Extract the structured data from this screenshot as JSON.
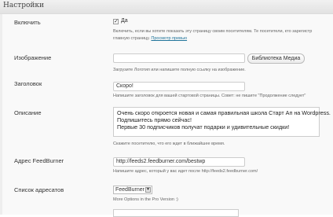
{
  "header": {
    "title": "Настройки"
  },
  "enable": {
    "label": "Включить",
    "checkbox_text": "Да",
    "hint_line1": "Включить, если вы хотите показать эту страницу своим посетителям. Те посетители, кто зарегистр",
    "hint_line2_prefix": "главную страницу.",
    "hint_link": "Просмотр превью"
  },
  "image": {
    "label": "Изображение",
    "value": "",
    "button_label": "Библиотека Медиа",
    "hint": "Загрузите Логотип или напишите полную ссылку на изображение."
  },
  "title_field": {
    "label": "Заголовок",
    "value": "Скоро!",
    "hint": "Напишите заголовок для вашей стартовой страницы. Совет: не пишите \"Продолжение следует\""
  },
  "description": {
    "label": "Описание",
    "lines": [
      "Очень скоро откроется новая и самая правильная школа Старт Ап на Wordpress.",
      "Подпишитесь прямо сейчас!",
      "Первые 30 подписчиков получат подарки и удивительные скидки!"
    ],
    "hint": "Скажите посетителю, что его ждет в ближайшее время."
  },
  "feedburner": {
    "label": "Адрес FeedBurner",
    "value": "http://feeds2.feedburner.com/bestwp",
    "hint": "Напишите адрес, который у вас идет после http://feeds2.feedburner.com/"
  },
  "address_list": {
    "label": "Список адресатов",
    "selected": "FeedBurner",
    "hint": "More Options in the Pro Version :)"
  }
}
